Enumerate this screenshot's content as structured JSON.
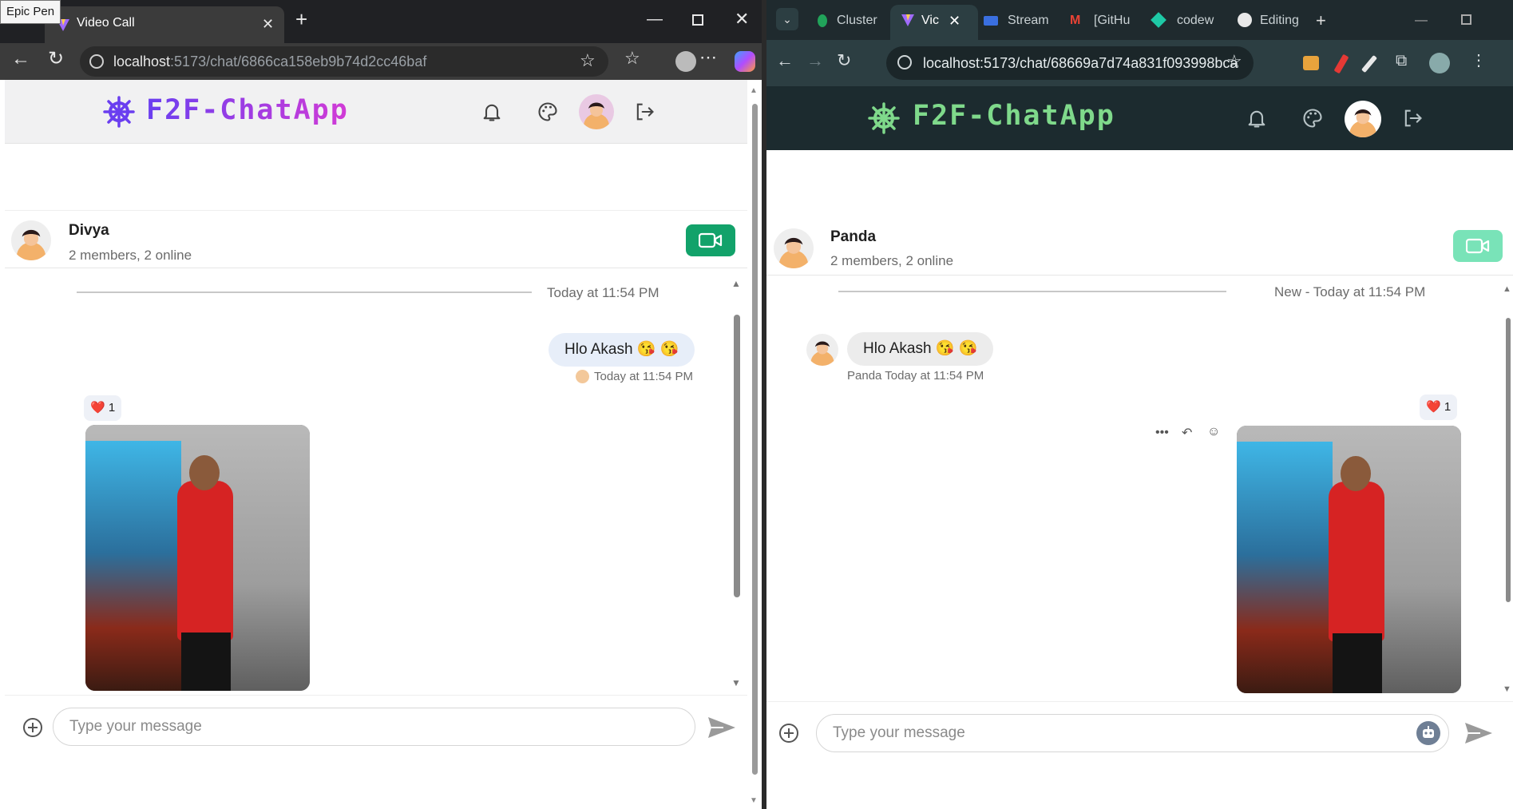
{
  "left_window": {
    "tooltip": "Epic Pen",
    "tab_title": "Video Call",
    "url_host": "localhost",
    "url_path": ":5173/chat/6866ca158eb9b74d2cc46baf",
    "app_name": "F2F-ChatApp",
    "channel": {
      "name": "Divya",
      "subtitle": "2 members, 2 online"
    },
    "date_separator": "Today at 11:54 PM",
    "message": {
      "text": "Hlo Akash 😘 😘",
      "meta": "Today at 11:54 PM"
    },
    "reaction": {
      "emoji": "❤️",
      "count": "1"
    },
    "input_placeholder": "Type your message"
  },
  "right_window": {
    "tabs": [
      "Cluster",
      "Vic",
      "Stream",
      "[GitHu",
      "codew",
      "Editing"
    ],
    "url": "localhost:5173/chat/68669a7d74a831f093998bca",
    "app_name": "F2F-ChatApp",
    "channel": {
      "name": "Panda",
      "subtitle": "2 members, 2 online"
    },
    "date_separator": "New - Today at 11:54 PM",
    "message": {
      "text": "Hlo Akash 😘 😘",
      "meta": "Panda Today at 11:54 PM"
    },
    "reaction": {
      "emoji": "❤️",
      "count": "1"
    },
    "message_actions": [
      "more-icon",
      "reply-icon",
      "emoji-icon"
    ],
    "input_placeholder": "Type your message"
  },
  "colors": {
    "logo_left_start": "#6a3ef0",
    "logo_left_end": "#d23bd6",
    "logo_right": "#7fd98b",
    "video_left": "#12a26a",
    "video_right": "#79e3b8"
  }
}
